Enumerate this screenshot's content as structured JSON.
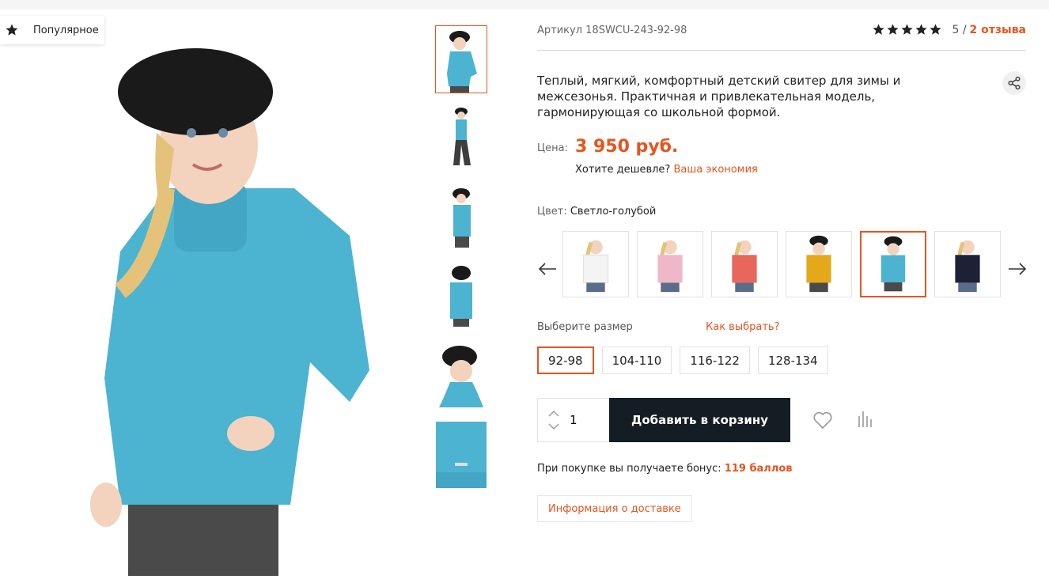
{
  "badge": {
    "label": "Популярное",
    "icon": "star-icon"
  },
  "product": {
    "sku": "Артикул 18SWCU-243-92-98",
    "rating": {
      "stars": 5,
      "value_text": "5 /",
      "reviews_link": "2 отзыва"
    },
    "description": "Теплый, мягкий, комфортный детский свитер для зимы и межсезонья. Практичная и привлекательная модель, гармонирующая со школьной формой.",
    "price_label": "Цена:",
    "price": "3 950 руб.",
    "cheaper_text": "Хотите дешевле?",
    "cheaper_link": "Ваша экономия",
    "color_label": "Цвет:",
    "color_value": "Светло-голубой",
    "colors": [
      {
        "name": "white",
        "hex": "#f4f4f4"
      },
      {
        "name": "pink",
        "hex": "#efb8c8"
      },
      {
        "name": "coral",
        "hex": "#e9665a"
      },
      {
        "name": "mustard",
        "hex": "#e3a91a"
      },
      {
        "name": "light-blue",
        "hex": "#4cb3d1",
        "active": true
      },
      {
        "name": "navy",
        "hex": "#1c2136"
      }
    ],
    "size_label": "Выберите размер",
    "size_help": "Как выбрать?",
    "sizes": [
      "92-98",
      "104-110",
      "116-122",
      "128-134"
    ],
    "selected_size": "92-98",
    "quantity": "1",
    "add_to_cart": "Добавить в корзину",
    "bonus_text": "При покупке вы получаете бонус:",
    "bonus_value": "119 баллов",
    "delivery_button": "Информация о доставке"
  },
  "colors": {
    "accent": "#e8541e",
    "dark_button": "#141c24",
    "sweater": "#4cb3d1"
  }
}
